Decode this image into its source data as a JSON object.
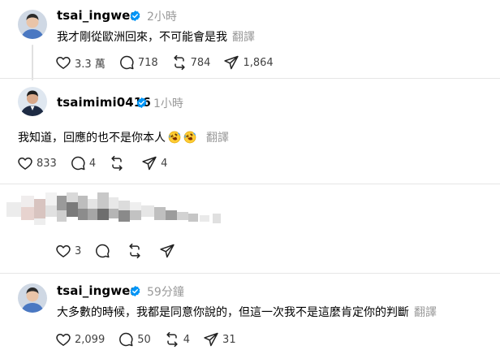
{
  "posts": [
    {
      "username": "tsai_ingwen",
      "time": "2小時",
      "text": "我才剛從歐洲回來，不可能會是我",
      "translate": "翻譯",
      "likes": "3.3 萬",
      "replies": "718",
      "reposts": "784",
      "shares": "1,864"
    },
    {
      "username": "tsaimimi0416",
      "time": "1小時",
      "text": "我知道，回應的也不是你本人",
      "translate": "翻譯",
      "likes": "833",
      "replies": "4",
      "reposts": "",
      "shares": "4"
    },
    {
      "username": "",
      "time": "",
      "text": "",
      "likes": "3",
      "replies": "",
      "reposts": "",
      "shares": ""
    },
    {
      "username": "tsai_ingwen",
      "time": "59分鐘",
      "text": "大多數的時候，我都是同意你說的，但這一次我不是這麼肯定你的判斷",
      "translate": "翻譯",
      "likes": "2,099",
      "replies": "50",
      "reposts": "4",
      "shares": "31"
    }
  ],
  "colors": {
    "verified": "#0095f6",
    "muted": "#999999",
    "divider": "#e6e6e6"
  },
  "icons": [
    "heart-icon",
    "comment-icon",
    "repost-icon",
    "share-icon",
    "verified-badge-icon",
    "rofl-emoji"
  ]
}
